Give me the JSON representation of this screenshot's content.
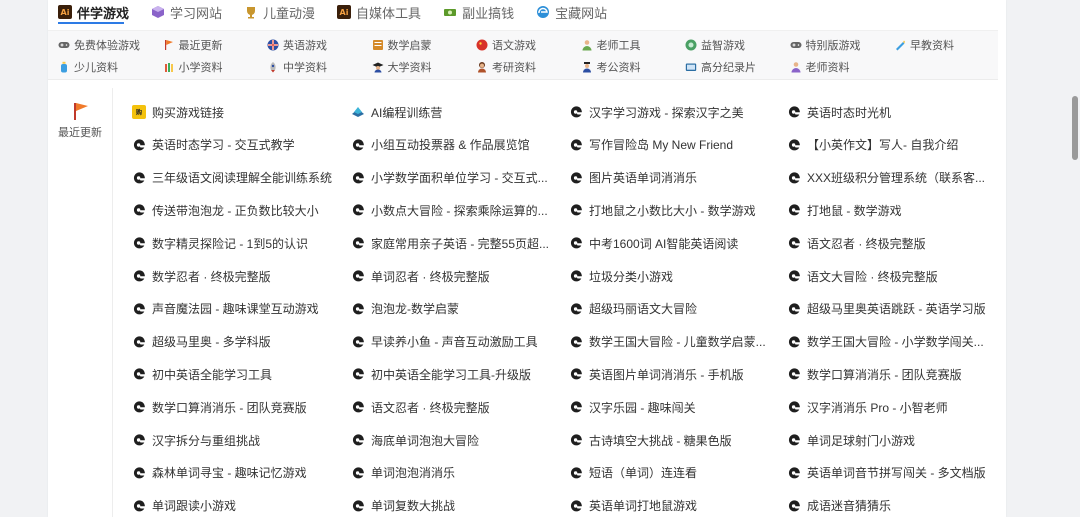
{
  "tabs": [
    {
      "label": "伴学游戏",
      "active": true,
      "icon": "ai-badge-icon",
      "color": "#b3621b"
    },
    {
      "label": "学习网站",
      "active": false,
      "icon": "cube-icon",
      "color": "#8a63c9"
    },
    {
      "label": "儿童动漫",
      "active": false,
      "icon": "trophy-icon",
      "color": "#c8962e"
    },
    {
      "label": "自媒体工具",
      "active": false,
      "icon": "ai-badge-icon",
      "color": "#b3621b"
    },
    {
      "label": "副业搞钱",
      "active": false,
      "icon": "money-icon",
      "color": "#5c9a2a"
    },
    {
      "label": "宝藏网站",
      "active": false,
      "icon": "edge-icon",
      "color": "#2d8fd8"
    }
  ],
  "subcategories": {
    "row1": [
      {
        "label": "免费体验游戏",
        "icon": "gamepad-icon",
        "color": "#555"
      },
      {
        "label": "最近更新",
        "icon": "flag-icon",
        "color": "#f07a2a"
      },
      {
        "label": "英语游戏",
        "icon": "uk-flag-icon",
        "color": "#2c4ea3"
      },
      {
        "label": "数学启蒙",
        "icon": "abacus-icon",
        "color": "#d48a2a"
      },
      {
        "label": "语文游戏",
        "icon": "china-flag-icon",
        "color": "#d8322a"
      },
      {
        "label": "老师工具",
        "icon": "teacher-icon",
        "color": "#6aa84f"
      },
      {
        "label": "益智游戏",
        "icon": "puzzle-icon",
        "color": "#4aa064"
      },
      {
        "label": "特别版游戏",
        "icon": "gamepad-icon",
        "color": "#555"
      },
      {
        "label": "早教资料",
        "icon": "crayon-icon",
        "color": "#3c9ee0"
      }
    ],
    "row2": [
      {
        "label": "少儿资料",
        "icon": "bottle-icon",
        "color": "#3c9ee0"
      },
      {
        "label": "小学资料",
        "icon": "crayons-icon",
        "color": "#e05a3a"
      },
      {
        "label": "中学资料",
        "icon": "rocket-icon",
        "color": "#c0392b"
      },
      {
        "label": "大学资料",
        "icon": "graduate-icon",
        "color": "#2c4ea3"
      },
      {
        "label": "考研资料",
        "icon": "student-icon",
        "color": "#b0522a"
      },
      {
        "label": "考公资料",
        "icon": "officer-icon",
        "color": "#2c4ea3"
      },
      {
        "label": "高分纪录片",
        "icon": "tv-icon",
        "color": "#2c6ea3"
      },
      {
        "label": "老师资料",
        "icon": "teacher-icon",
        "color": "#8a63c9"
      }
    ]
  },
  "sidebar": {
    "label": "最近更新",
    "icon": "flag-icon",
    "color": "#f07a2a"
  },
  "items": [
    {
      "label": "购买游戏链接",
      "icon": "shop-badge-icon"
    },
    {
      "label": "AI编程训练营",
      "icon": "ai-course-icon"
    },
    {
      "label": "汉字学习游戏 - 探索汉字之美",
      "icon": "game-logo-icon"
    },
    {
      "label": "英语时态时光机",
      "icon": "game-logo-icon"
    },
    {
      "label": "英语时态学习 - 交互式教学",
      "icon": "game-logo-icon"
    },
    {
      "label": "小组互动投票器 & 作品展览馆",
      "icon": "game-logo-icon"
    },
    {
      "label": "写作冒险岛 My New Friend",
      "icon": "game-logo-icon"
    },
    {
      "label": "【小英作文】写人- 自我介绍",
      "icon": "game-logo-icon"
    },
    {
      "label": "三年级语文阅读理解全能训练系统",
      "icon": "game-logo-icon"
    },
    {
      "label": "小学数学面积单位学习 - 交互式...",
      "icon": "game-logo-icon"
    },
    {
      "label": "图片英语单词消消乐",
      "icon": "game-logo-icon"
    },
    {
      "label": "XXX班级积分管理系统（联系客...",
      "icon": "game-logo-icon"
    },
    {
      "label": "传送带泡泡龙 - 正负数比较大小",
      "icon": "game-logo-icon"
    },
    {
      "label": "小数点大冒险 - 探索乘除运算的...",
      "icon": "game-logo-icon"
    },
    {
      "label": "打地鼠之小数比大小 - 数学游戏",
      "icon": "game-logo-icon"
    },
    {
      "label": "打地鼠 - 数学游戏",
      "icon": "game-logo-icon"
    },
    {
      "label": "数字精灵探险记 - 1到5的认识",
      "icon": "game-logo-icon"
    },
    {
      "label": "家庭常用亲子英语 - 完整55页超...",
      "icon": "game-logo-icon"
    },
    {
      "label": "中考1600词 AI智能英语阅读",
      "icon": "game-logo-icon"
    },
    {
      "label": "语文忍者 · 终极完整版",
      "icon": "game-logo-icon"
    },
    {
      "label": "数学忍者 · 终极完整版",
      "icon": "game-logo-icon"
    },
    {
      "label": "单词忍者 · 终极完整版",
      "icon": "game-logo-icon"
    },
    {
      "label": "垃圾分类小游戏",
      "icon": "game-logo-icon"
    },
    {
      "label": "语文大冒险 · 终极完整版",
      "icon": "game-logo-icon"
    },
    {
      "label": "声音魔法园 - 趣味课堂互动游戏",
      "icon": "game-logo-icon"
    },
    {
      "label": "泡泡龙-数学启蒙",
      "icon": "game-logo-icon"
    },
    {
      "label": "超级玛丽语文大冒险",
      "icon": "game-logo-icon"
    },
    {
      "label": "超级马里奥英语跳跃 - 英语学习版",
      "icon": "game-logo-icon"
    },
    {
      "label": "超级马里奥 - 多学科版",
      "icon": "game-logo-icon"
    },
    {
      "label": "早读养小鱼 - 声音互动激励工具",
      "icon": "game-logo-icon"
    },
    {
      "label": "数学王国大冒险 - 儿童数学启蒙...",
      "icon": "game-logo-icon"
    },
    {
      "label": "数学王国大冒险 - 小学数学闯关...",
      "icon": "game-logo-icon"
    },
    {
      "label": "初中英语全能学习工具",
      "icon": "game-logo-icon"
    },
    {
      "label": "初中英语全能学习工具-升级版",
      "icon": "game-logo-icon"
    },
    {
      "label": "英语图片单词消消乐 - 手机版",
      "icon": "game-logo-icon"
    },
    {
      "label": "数学口算消消乐 - 团队竞赛版",
      "icon": "game-logo-icon"
    },
    {
      "label": "数学口算消消乐 - 团队竞赛版",
      "icon": "game-logo-icon"
    },
    {
      "label": "语文忍者 · 终极完整版",
      "icon": "game-logo-icon"
    },
    {
      "label": "汉字乐园 - 趣味闯关",
      "icon": "game-logo-icon"
    },
    {
      "label": "汉字消消乐 Pro - 小智老师",
      "icon": "game-logo-icon"
    },
    {
      "label": "汉字拆分与重组挑战",
      "icon": "game-logo-icon"
    },
    {
      "label": "海底单词泡泡大冒险",
      "icon": "game-logo-icon"
    },
    {
      "label": "古诗填空大挑战 - 糖果色版",
      "icon": "game-logo-icon"
    },
    {
      "label": "单词足球射门小游戏",
      "icon": "game-logo-icon"
    },
    {
      "label": "森林单词寻宝 - 趣味记忆游戏",
      "icon": "game-logo-icon"
    },
    {
      "label": "单词泡泡消消乐",
      "icon": "game-logo-icon"
    },
    {
      "label": "短语（单词）连连看",
      "icon": "game-logo-icon"
    },
    {
      "label": "英语单词音节拼写闯关 - 多文档版",
      "icon": "game-logo-icon"
    },
    {
      "label": "单词跟读小游戏",
      "icon": "game-logo-icon"
    },
    {
      "label": "单词复数大挑战",
      "icon": "game-logo-icon"
    },
    {
      "label": "英语单词打地鼠游戏",
      "icon": "game-logo-icon"
    },
    {
      "label": "成语迷音猜猜乐",
      "icon": "game-logo-icon"
    }
  ],
  "colors": {
    "accent": "#2d7be5",
    "text": "#333333",
    "muted": "#666666",
    "logo": "#1f1f1f"
  }
}
